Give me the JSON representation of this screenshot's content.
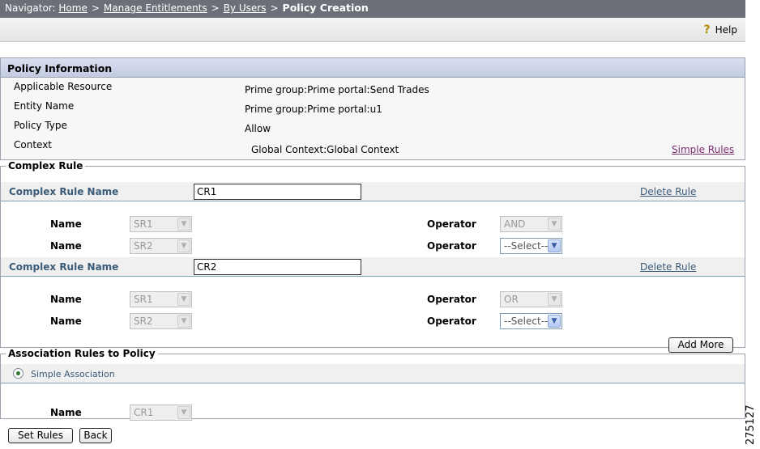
{
  "nav": {
    "prefix": "Navigator:",
    "home": "Home",
    "manage": "Manage Entitlements",
    "byusers": "By Users",
    "current": "Policy Creation",
    "sep": ">"
  },
  "toolbar": {
    "help_label": "Help",
    "help_glyph": "?"
  },
  "policy_info": {
    "title": "Policy Information",
    "rows": [
      {
        "label": "Applicable Resource",
        "value": "Prime group:Prime portal:Send Trades"
      },
      {
        "label": "Entity Name",
        "value": "Prime group:Prime portal:u1"
      },
      {
        "label": "Policy Type",
        "value": "Allow"
      },
      {
        "label": "Context",
        "value": "Global Context:Global Context"
      }
    ],
    "simple_rules_link": "Simple Rules"
  },
  "complex_rule": {
    "legend": "Complex Rule",
    "rules": [
      {
        "name_label": "Complex Rule Name",
        "name_value": "CR1",
        "delete_label": "Delete Rule",
        "rows": [
          {
            "name_label": "Name",
            "name_value": "SR1",
            "op_label": "Operator",
            "op_value": "AND",
            "op_disabled": true
          },
          {
            "name_label": "Name",
            "name_value": "SR2",
            "op_label": "Operator",
            "op_value": "--Select--",
            "op_disabled": false
          }
        ]
      },
      {
        "name_label": "Complex Rule Name",
        "name_value": "CR2",
        "delete_label": "Delete Rule",
        "rows": [
          {
            "name_label": "Name",
            "name_value": "SR1",
            "op_label": "Operator",
            "op_value": "OR",
            "op_disabled": true
          },
          {
            "name_label": "Name",
            "name_value": "SR2",
            "op_label": "Operator",
            "op_value": "--Select--",
            "op_disabled": false
          }
        ]
      }
    ],
    "add_more_label": "Add More"
  },
  "association": {
    "legend": "Association Rules to Policy",
    "option_label": "Simple Association",
    "name_label": "Name",
    "name_value": "CR1"
  },
  "footer": {
    "set_rules_label": "Set Rules",
    "back_label": "Back"
  },
  "figure_id": "275127",
  "icons": {
    "dropdown": "chevron-down-icon",
    "help": "help-icon"
  }
}
